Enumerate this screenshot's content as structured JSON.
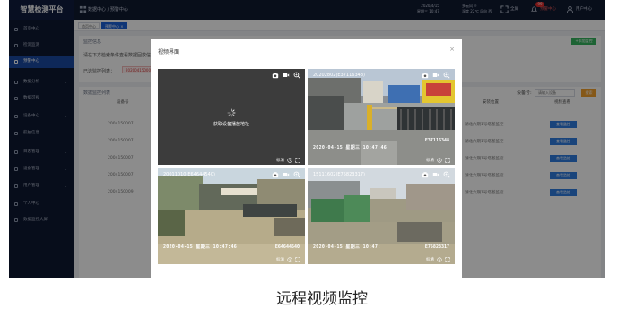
{
  "app": {
    "title": "智慧检测平台",
    "breadcrumb": "数据中心 / 预警中心",
    "date": "2020/4/15",
    "weekday_time": "星期三 10:47",
    "weather_line1": "多云风 ☼",
    "weather_line2": "温度 22℃ 风向 西",
    "fullscreen_label": "全屏",
    "alert_badge": "99",
    "alert_label": "预警中心",
    "user_label": "用户中心"
  },
  "sidebar": {
    "items": [
      {
        "label": "首页中心"
      },
      {
        "label": "检测监测"
      },
      {
        "label": "预警中心"
      },
      {
        "label": "数据分析"
      },
      {
        "label": "数据可视"
      },
      {
        "label": "设备中心"
      },
      {
        "label": "航拍信息"
      },
      {
        "label": "日志管理"
      },
      {
        "label": "设备管理"
      },
      {
        "label": "用户管理"
      },
      {
        "label": "个人中心"
      },
      {
        "label": "数据监控大屏"
      }
    ]
  },
  "tabs": [
    {
      "label": "首页中心"
    },
    {
      "label": "预警中心 ×"
    }
  ],
  "top_panel": {
    "title": "监控信息",
    "hint": "请在下方检索条件查看数据回放信息",
    "selected_label": "已选监控列表：",
    "selected_tag": "20200415000",
    "add_button": "+添加监控"
  },
  "table_panel": {
    "title": "数据监控列表",
    "search_label": "设备号:",
    "search_placeholder": "请输入设备",
    "search_button": "搜索",
    "columns": [
      "设备号",
      "安装位置",
      "视频查看"
    ],
    "rows": [
      {
        "id": "2004150007",
        "location": "湖北六期1号塔基监控",
        "action": "查看监控"
      },
      {
        "id": "2004150007",
        "location": "湖北六期1号塔基监控",
        "action": "查看监控"
      },
      {
        "id": "2004150007",
        "location": "湖北六期1号塔基监控",
        "action": "查看监控"
      },
      {
        "id": "2004150007",
        "location": "湖北六期1号塔基监控",
        "action": "查看监控"
      },
      {
        "id": "2004150009",
        "location": "湖北六期1号塔基监控",
        "action": "查看监控"
      }
    ]
  },
  "modal": {
    "title": "视频界面",
    "close": "×",
    "feeds": [
      {
        "name": "",
        "loading_text": "获取设备播放地址",
        "osd_time": "",
        "osd_id": "",
        "speed": "标清"
      },
      {
        "name": "20202802(E37116348)",
        "loading_text": "",
        "osd_time": "2020-04-15 星期三 10:47:46",
        "osd_id": "E37116348",
        "speed": "标清"
      },
      {
        "name": "20011010(E64644540)",
        "loading_text": "",
        "osd_time": "2020-04-15 星期三 10:47:46",
        "osd_id": "E64644540",
        "speed": "标清"
      },
      {
        "name": "15111602(E75823317)",
        "loading_text": "",
        "osd_time": "2020-04-15 星期三 10:47:",
        "osd_id": "E75823317",
        "speed": "标清"
      }
    ]
  },
  "caption": "远程视频监控",
  "colors": {
    "sidebar": "#0e1832",
    "accent": "#1d62d8",
    "green": "#35b560",
    "orange": "#f3a12d"
  }
}
